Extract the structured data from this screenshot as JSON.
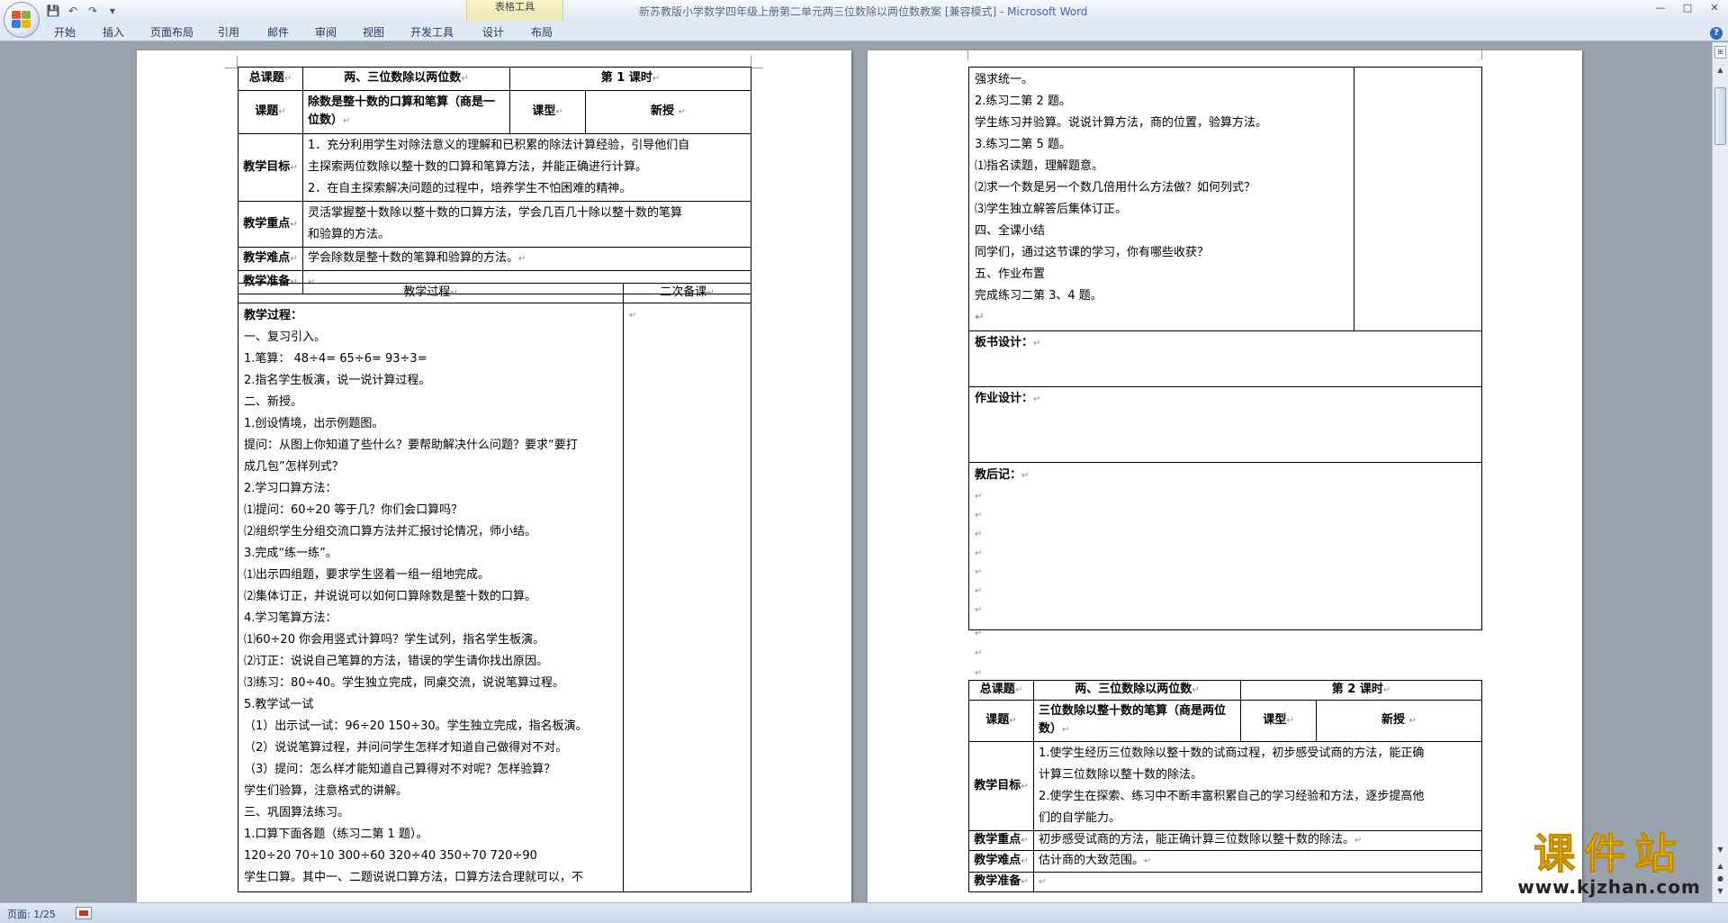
{
  "window": {
    "title": "新苏教版小学数学四年级上册第二单元两三位数除以两位数教案 [兼容模式] - ",
    "app_name": "Microsoft Word",
    "context_tab_group": "表格工具",
    "controls": [
      "—",
      "□",
      "✕"
    ]
  },
  "quick_access": {
    "save_icon": "💾",
    "undo_icon": "↶",
    "redo_icon": "↷",
    "customize_icon": "▾"
  },
  "ribbon": {
    "tabs": [
      "开始",
      "插入",
      "页面布局",
      "引用",
      "邮件",
      "审阅",
      "视图",
      "开发工具",
      "设计",
      "布局"
    ]
  },
  "status": {
    "page_info": "页面: 1/25"
  },
  "lesson1": {
    "zkt_label": "总课题",
    "zkt_value": "两、三位数除以两位数",
    "period": "第 1 课时",
    "kt_label": "课题",
    "kt_value": "除数是整十数的口算和笔算（商是一位数）",
    "kx_label": "课型",
    "kx_value": "新授",
    "goal_label": "教学目标",
    "goals": [
      "  1．充分利用学生对除法意义的理解和已积累的除法计算经验，引导他们自",
      "主探索两位数除以整十数的口算和笔算方法，并能正确进行计算。",
      "2．在自主探索解决问题的过程中，培养学生不怕困难的精神。"
    ],
    "focus_label": "教学重点",
    "focus": [
      "  灵活掌握整十数除以整十数的口算方法，学会几百几十除以整十数的笔算",
      "和验算的方法。"
    ],
    "diff_label": "教学难点",
    "diff": "学会除数是整十数的笔算和验算的方法。",
    "prep_label": "教学准备",
    "prep": "",
    "proc_header": "教学过程",
    "second_header": "二次备课",
    "process": [
      "教学过程：",
      "一、复习引入。",
      "1.笔算： 48÷4=            65÷6=          93÷3=",
      "2.指名学生板演，说一说计算过程。",
      "二、新授。",
      "1.创设情境，出示例题图。",
      "提问：从图上你知道了些什么？要帮助解决什么问题？要求“要打",
      "成几包”怎样列式？",
      "2.学习口算方法：",
      "⑴提问：60÷20 等于几？你们会口算吗？",
      "⑵组织学生分组交流口算方法并汇报讨论情况，师小结。",
      "3.完成“练一练”。",
      "⑴出示四组题，要求学生竖着一组一组地完成。",
      "⑵集体订正，并说说可以如何口算除数是整十数的口算。",
      "4.学习笔算方法：",
      "⑴60÷20 你会用竖式计算吗？学生试列，指名学生板演。",
      "⑵订正：说说自己笔算的方法，错误的学生请你找出原因。",
      "⑶练习：80÷40。学生独立完成，同桌交流，说说笔算过程。",
      "5.教学试一试",
      "（1）出示试一试：96÷20   150÷30。学生独立完成，指名板演。",
      "（2）说说笔算过程，并问问学生怎样才知道自己做得对不对。",
      "（3）提问：怎么样才能知道自己算得对不对呢？怎样验算？",
      "        学生们验算，注意格式的讲解。",
      "三、巩固算法练习。",
      "1.口算下面各题（练习二第 1 题）。",
      "120÷20   70÷10   300÷60   320÷40   350÷70    720÷90",
      "学生口算。其中一、二题说说口算方法，口算方法合理就可以，不"
    ]
  },
  "lesson1_cont": {
    "process": [
      "强求统一。",
      "2.练习二第 2 题。",
      "学生练习并验算。说说计算方法，商的位置，验算方法。",
      "3.练习二第 5 题。",
      "⑴指名读题，理解题意。",
      "⑵求一个数是另一个数几倍用什么方法做？如何列式？",
      "⑶学生独立解答后集体订正。",
      "四、全课小结",
      "同学们，通过这节课的学习，你有哪些收获？",
      "五、作业布置",
      "完成练习二第 3、4 题。",
      ""
    ],
    "board_label": "板书设计：",
    "homework_label": "作业设计：",
    "reflection_label": "教后记："
  },
  "lesson2": {
    "zkt_label": "总课题",
    "zkt_value": "两、三位数除以两位数",
    "period": "第 2 课时",
    "kt_label": "课题",
    "kt_value": "三位数除以整十数的笔算（商是两位数）",
    "kx_label": "课型",
    "kx_value": "新授",
    "goal_label": "教学目标",
    "goals": [
      "1.使学生经历三位数除以整十数的试商过程，初步感受试商的方法，能正确",
      "计算三位数除以整十数的除法。",
      "2.使学生在探索、练习中不断丰富积累自己的学习经验和方法，逐步提高他",
      "们的自学能力。"
    ],
    "focus_label": "教学重点",
    "focus": "   初步感受试商的方法，能正确计算三位数除以整十数的除法。",
    "diff_label": "教学难点",
    "diff": "估计商的大致范围。",
    "prep_label": "教学准备",
    "prep": ""
  },
  "marks": {
    "cell_end": "↵",
    "para": "↵"
  },
  "watermark": {
    "title": "课件站",
    "url": "www.kjzhan.com"
  },
  "colors": {
    "ribbon_bg": "#dfe8f3",
    "workspace_bg": "#9aa3ad",
    "title_app": "#4a62a8",
    "watermark_yellow": "#f5c400"
  }
}
